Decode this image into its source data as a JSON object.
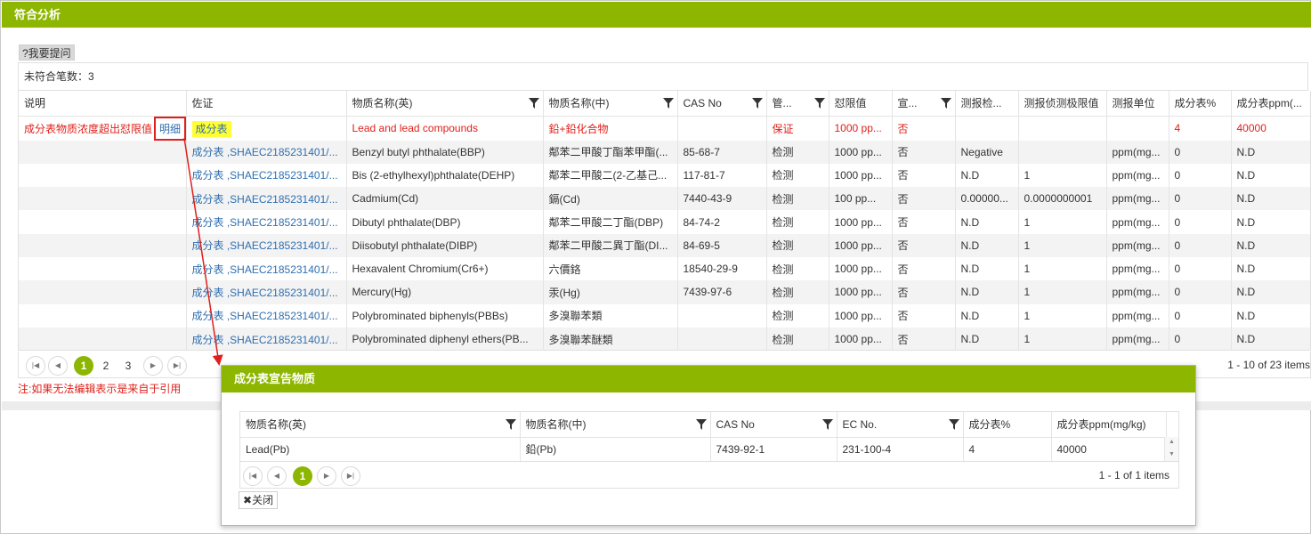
{
  "panel": {
    "title": "符合分析"
  },
  "ask_button": "?我要提问",
  "nonconform_count": "未符合笔数：3",
  "main_grid": {
    "columns": [
      "说明",
      "佐证",
      "物质名称(英)",
      "物质名称(中)",
      "CAS No",
      "管...",
      "怼限值",
      "宣...",
      "测报检...",
      "测报侦测极限值",
      "测报单位",
      "成分表%",
      "成分表ppm(..."
    ],
    "first_row": {
      "desc": "成分表物质浓度超出怼限值",
      "detail": "明细",
      "evidence": "成分表",
      "name_en": "Lead and lead compounds",
      "name_cn": "鉛+鉛化合物",
      "cas": "",
      "control": "保证",
      "limit": "1000 pp...",
      "declare": "否",
      "report_check": "",
      "report_limit": "",
      "report_unit": "",
      "pct": "4",
      "ppm": "40000"
    },
    "rows": [
      {
        "evidence": "成分表 ,SHAEC2185231401/...",
        "name_en": "Benzyl butyl phthalate(BBP)",
        "name_cn": "鄰苯二甲酸丁酯苯甲酯(...",
        "cas": "85-68-7",
        "control": "检测",
        "limit": "1000 pp...",
        "declare": "否",
        "report_check": "Negative",
        "report_limit": "",
        "report_unit": "ppm(mg...",
        "pct": "0",
        "ppm": "N.D"
      },
      {
        "evidence": "成分表 ,SHAEC2185231401/...",
        "name_en": "Bis (2-ethylhexyl)phthalate(DEHP)",
        "name_cn": "鄰苯二甲酸二(2-乙基己...",
        "cas": "117-81-7",
        "control": "检测",
        "limit": "1000 pp...",
        "declare": "否",
        "report_check": "N.D",
        "report_limit": "1",
        "report_unit": "ppm(mg...",
        "pct": "0",
        "ppm": "N.D"
      },
      {
        "evidence": "成分表 ,SHAEC2185231401/...",
        "name_en": "Cadmium(Cd)",
        "name_cn": "鎘(Cd)",
        "cas": "7440-43-9",
        "control": "检测",
        "limit": "100 pp...",
        "declare": "否",
        "report_check": "0.00000...",
        "report_limit": "0.0000000001",
        "report_unit": "ppm(mg...",
        "pct": "0",
        "ppm": "N.D"
      },
      {
        "evidence": "成分表 ,SHAEC2185231401/...",
        "name_en": "Dibutyl phthalate(DBP)",
        "name_cn": "鄰苯二甲酸二丁酯(DBP)",
        "cas": "84-74-2",
        "control": "检测",
        "limit": "1000 pp...",
        "declare": "否",
        "report_check": "N.D",
        "report_limit": "1",
        "report_unit": "ppm(mg...",
        "pct": "0",
        "ppm": "N.D"
      },
      {
        "evidence": "成分表 ,SHAEC2185231401/...",
        "name_en": "Diisobutyl phthalate(DIBP)",
        "name_cn": "鄰苯二甲酸二異丁酯(DI...",
        "cas": "84-69-5",
        "control": "检测",
        "limit": "1000 pp...",
        "declare": "否",
        "report_check": "N.D",
        "report_limit": "1",
        "report_unit": "ppm(mg...",
        "pct": "0",
        "ppm": "N.D"
      },
      {
        "evidence": "成分表 ,SHAEC2185231401/...",
        "name_en": "Hexavalent Chromium(Cr6+)",
        "name_cn": "六價鉻",
        "cas": "18540-29-9",
        "control": "检测",
        "limit": "1000 pp...",
        "declare": "否",
        "report_check": "N.D",
        "report_limit": "1",
        "report_unit": "ppm(mg...",
        "pct": "0",
        "ppm": "N.D"
      },
      {
        "evidence": "成分表 ,SHAEC2185231401/...",
        "name_en": "Mercury(Hg)",
        "name_cn": "汞(Hg)",
        "cas": "7439-97-6",
        "control": "检测",
        "limit": "1000 pp...",
        "declare": "否",
        "report_check": "N.D",
        "report_limit": "1",
        "report_unit": "ppm(mg...",
        "pct": "0",
        "ppm": "N.D"
      },
      {
        "evidence": "成分表 ,SHAEC2185231401/...",
        "name_en": "Polybrominated biphenyls(PBBs)",
        "name_cn": "多溴聯苯類",
        "cas": "",
        "control": "检测",
        "limit": "1000 pp...",
        "declare": "否",
        "report_check": "N.D",
        "report_limit": "1",
        "report_unit": "ppm(mg...",
        "pct": "0",
        "ppm": "N.D"
      },
      {
        "evidence": "成分表 ,SHAEC2185231401/...",
        "name_en": "Polybrominated diphenyl ethers(PB...",
        "name_cn": "多溴聯苯醚類",
        "cas": "",
        "control": "检测",
        "limit": "1000 pp...",
        "declare": "否",
        "report_check": "N.D",
        "report_limit": "1",
        "report_unit": "ppm(mg...",
        "pct": "0",
        "ppm": "N.D"
      }
    ]
  },
  "pager": {
    "pages": [
      "1",
      "2",
      "3"
    ],
    "active": "1",
    "info": "1 - 10 of 23 items"
  },
  "note": "注:如果无法编辑表示是来自于引用",
  "modal": {
    "title": "成分表宣告物质",
    "columns": [
      "物质名称(英)",
      "物质名称(中)",
      "CAS No",
      "EC No.",
      "成分表%",
      "成分表ppm(mg/kg)"
    ],
    "row": {
      "name_en": "Lead(Pb)",
      "name_cn": "鉛(Pb)",
      "cas": "7439-92-1",
      "ec": "231-100-4",
      "pct": "4",
      "ppm": "40000"
    },
    "pager": {
      "active": "1",
      "info": "1 - 1 of 1 items"
    },
    "close": "关闭"
  },
  "colors": {
    "accent": "#8db600",
    "error": "#e0201a",
    "link": "#2f6fb0",
    "highlight": "#ffff33"
  }
}
